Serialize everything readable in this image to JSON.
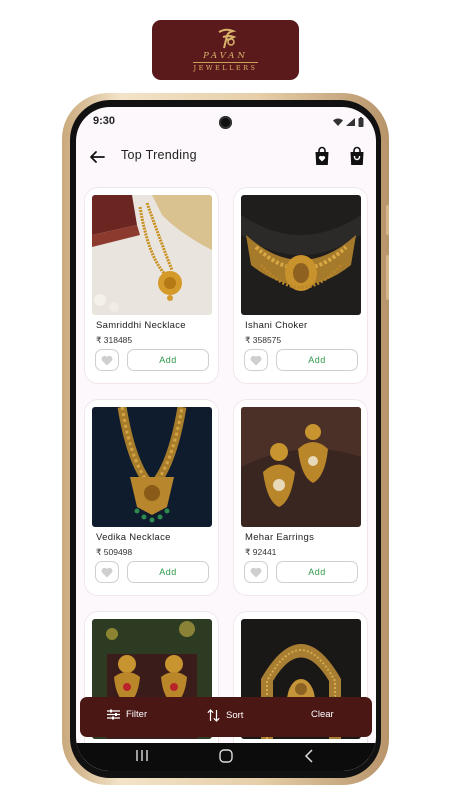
{
  "brand": {
    "name": "PAVAN",
    "sub": "JEWELLERS"
  },
  "status": {
    "time": "9:30"
  },
  "header": {
    "title": "Top Trending"
  },
  "products": [
    {
      "name": "Samriddhi Necklace",
      "price": "₹ 318485",
      "add_label": "Add",
      "image": "gold-necklace-on-cloth"
    },
    {
      "name": "Ishani Choker",
      "price": "₹ 358575",
      "add_label": "Add",
      "image": "gold-choker-on-dark"
    },
    {
      "name": "Vedika Necklace",
      "price": "₹ 509498",
      "add_label": "Add",
      "image": "long-gold-necklace-on-blue"
    },
    {
      "name": "Mehar Earrings",
      "price": "₹ 92441",
      "add_label": "Add",
      "image": "gold-chandbali-earrings"
    },
    {
      "name": "",
      "price": "",
      "add_label": "",
      "image": "earrings-with-stones"
    },
    {
      "name": "",
      "price": "",
      "add_label": "",
      "image": "gold-bangle-with-deity"
    }
  ],
  "bottom_bar": {
    "filter": "Filter",
    "sort": "Sort",
    "clear": "Clear"
  },
  "colors": {
    "brand": "#5a1a1c",
    "gold": "#d9b36a",
    "add_text": "#2f9a4a",
    "bar": "#4a1715"
  }
}
